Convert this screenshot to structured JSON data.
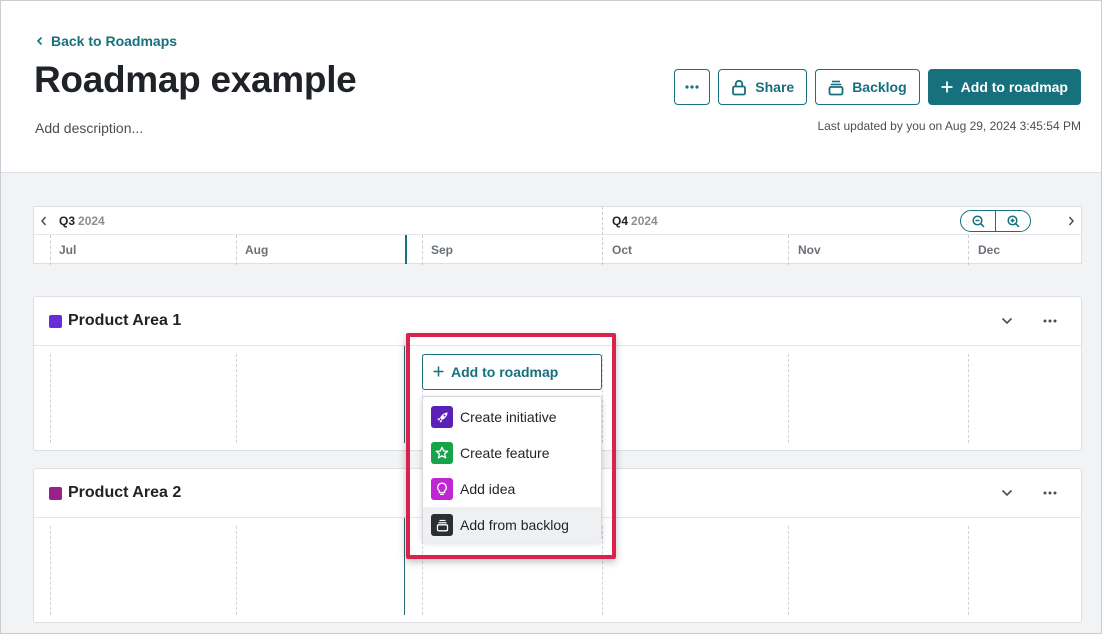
{
  "header": {
    "back_label": "Back to Roadmaps",
    "title": "Roadmap example",
    "description_placeholder": "Add description...",
    "last_updated": "Last updated by you on Aug 29, 2024 3:45:54 PM"
  },
  "toolbar": {
    "more_icon": "ellipsis-icon",
    "share_label": "Share",
    "share_icon": "lock-icon",
    "backlog_label": "Backlog",
    "backlog_icon": "stack-icon",
    "add_label": "Add to roadmap",
    "add_icon": "plus-icon"
  },
  "timeline": {
    "quarters": [
      {
        "q": "Q3",
        "year": "2024"
      },
      {
        "q": "Q4",
        "year": "2024"
      }
    ],
    "months": [
      "Jul",
      "Aug",
      "Sep",
      "Oct",
      "Nov",
      "Dec"
    ],
    "zoom_out_icon": "zoom-out-icon",
    "zoom_in_icon": "zoom-in-icon"
  },
  "lanes": [
    {
      "title": "Product Area 1",
      "color": "#6a2bd9"
    },
    {
      "title": "Product Area 2",
      "color": "#9c1f8c"
    }
  ],
  "dropdown": {
    "button_label": "Add to roadmap",
    "items": [
      {
        "label": "Create initiative",
        "icon": "rocket-icon",
        "color": "#5b21b6"
      },
      {
        "label": "Create feature",
        "icon": "star-icon",
        "color": "#16a34a"
      },
      {
        "label": "Add idea",
        "icon": "lightbulb-icon",
        "color": "#c026d3"
      },
      {
        "label": "Add from backlog",
        "icon": "stack-icon",
        "color": "#2b2f33"
      }
    ]
  },
  "colors": {
    "accent": "#16707e",
    "highlight": "#d9234f"
  }
}
